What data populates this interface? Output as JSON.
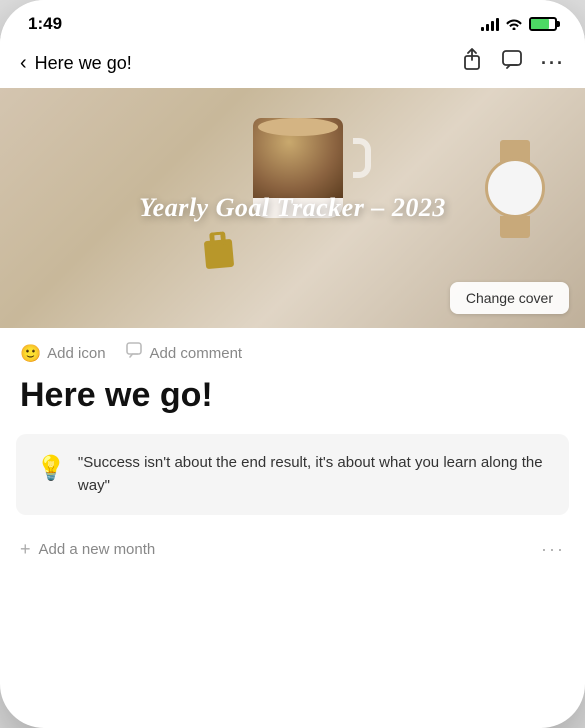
{
  "status": {
    "time": "1:49"
  },
  "nav": {
    "back_label": "‹",
    "title": "Here we go!",
    "share_icon": "⬆",
    "comment_icon": "💬",
    "more_icon": "···"
  },
  "cover": {
    "title": "Yearly Goal Tracker – 2023",
    "change_cover_label": "Change cover"
  },
  "actions": {
    "add_icon_label": "Add icon",
    "add_comment_label": "Add comment"
  },
  "page": {
    "title": "Here we go!"
  },
  "quote": {
    "icon": "💡",
    "text": "\"Success isn't about the end result, it's about what you learn along the way\""
  },
  "footer": {
    "add_month_label": "Add a new month",
    "plus_icon": "+",
    "more_icon": "···"
  }
}
